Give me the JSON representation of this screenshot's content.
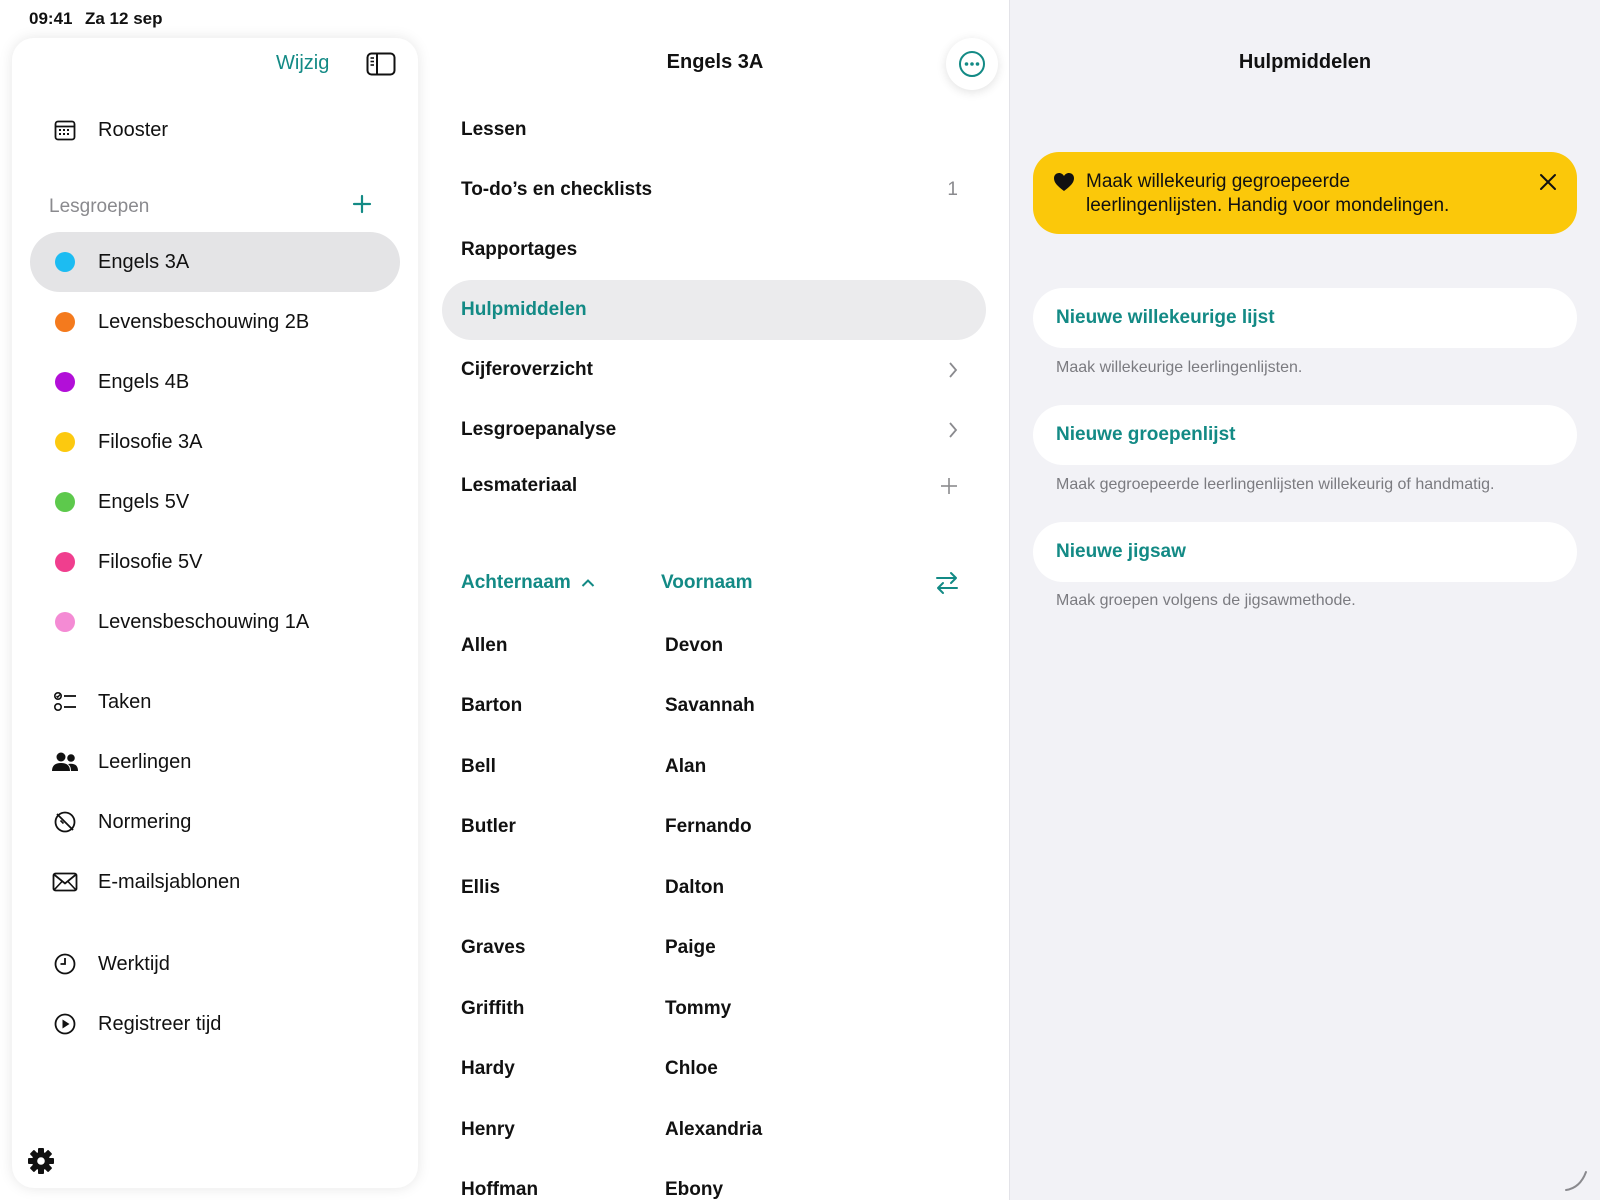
{
  "status_bar": {
    "time": "09:41",
    "date": "Za 12 sep"
  },
  "sidebar": {
    "edit_label": "Wijzig",
    "schedule": {
      "label": "Rooster",
      "icon": "calendar-icon"
    },
    "groups_header": "Lesgroepen",
    "groups": [
      {
        "label": "Engels 3A",
        "color": "#1cbcf2",
        "selected": true
      },
      {
        "label": "Levensbeschouwing 2B",
        "color": "#f47a1d"
      },
      {
        "label": "Engels 4B",
        "color": "#b20fd8"
      },
      {
        "label": "Filosofie 3A",
        "color": "#fcc90f"
      },
      {
        "label": "Engels 5V",
        "color": "#5dc94c"
      },
      {
        "label": "Filosofie 5V",
        "color": "#f03e8e"
      },
      {
        "label": "Levensbeschouwing 1A",
        "color": "#f48bd4"
      }
    ],
    "tools": [
      {
        "label": "Taken",
        "icon": "checklist-icon"
      },
      {
        "label": "Leerlingen",
        "icon": "people-icon"
      },
      {
        "label": "Normering",
        "icon": "grading-icon"
      },
      {
        "label": "E-mailsjablonen",
        "icon": "mail-icon"
      }
    ],
    "time": [
      {
        "label": "Werktijd",
        "icon": "clock-icon"
      },
      {
        "label": "Registreer tijd",
        "icon": "play-circle-icon"
      }
    ]
  },
  "middle": {
    "title": "Engels 3A",
    "menu": [
      {
        "label": "Lessen",
        "right": ""
      },
      {
        "label": "To-do’s en checklists",
        "right": "1"
      },
      {
        "label": "Rapportages",
        "right": ""
      },
      {
        "label": "Hulpmiddelen",
        "right": "",
        "selected": true
      },
      {
        "label": "Cijferoverzicht",
        "right": "chevron-right-icon"
      },
      {
        "label": "Lesgroepanalyse",
        "right": "chevron-right-icon"
      },
      {
        "label": "Lesmateriaal",
        "right": "plus-icon"
      }
    ],
    "columns": {
      "last_name": "Achternaam",
      "first_name": "Voornaam"
    },
    "students": [
      {
        "last": "Allen",
        "first": "Devon"
      },
      {
        "last": "Barton",
        "first": "Savannah"
      },
      {
        "last": "Bell",
        "first": "Alan"
      },
      {
        "last": "Butler",
        "first": "Fernando"
      },
      {
        "last": "Ellis",
        "first": "Dalton"
      },
      {
        "last": "Graves",
        "first": "Paige"
      },
      {
        "last": "Griffith",
        "first": "Tommy"
      },
      {
        "last": "Hardy",
        "first": "Chloe"
      },
      {
        "last": "Henry",
        "first": "Alexandria"
      },
      {
        "last": "Hoffman",
        "first": "Ebony"
      }
    ]
  },
  "right": {
    "title": "Hulpmiddelen",
    "banner": {
      "line1": "Maak willekeurig gegroepeerde",
      "line2": "leerlingenlijsten. Handig voor mondelingen."
    },
    "tools": [
      {
        "label": "Nieuwe willekeurige lijst",
        "description": "Maak willekeurige leerlingenlijsten."
      },
      {
        "label": "Nieuwe groepenlijst",
        "description": "Maak gegroepeerde leerlingenlijsten willekeurig of handmatig."
      },
      {
        "label": "Nieuwe jigsaw",
        "description": "Maak groepen volgens de jigsawmethode."
      }
    ]
  },
  "colors": {
    "accent": "#138a85",
    "banner": "#fbc80a",
    "selected_bg": "#e4e4e6"
  }
}
